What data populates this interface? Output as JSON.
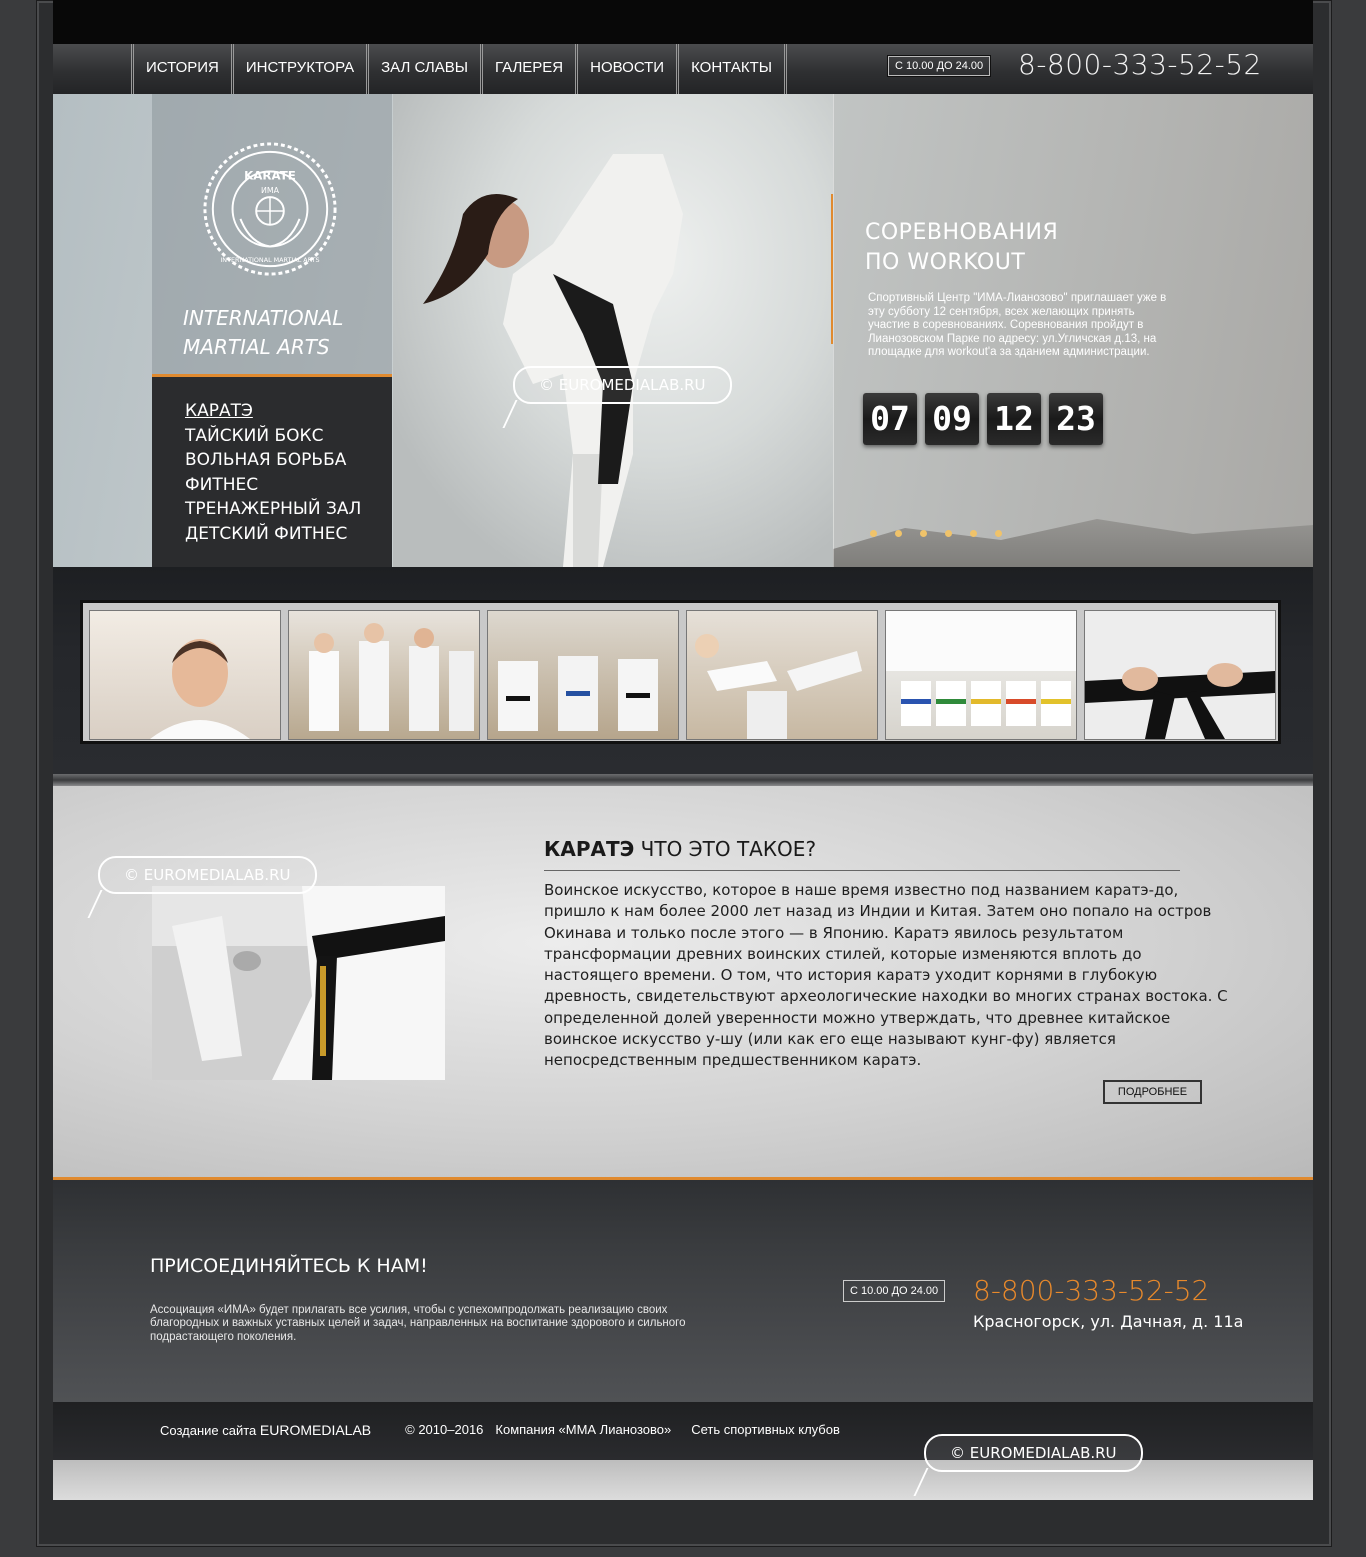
{
  "nav": {
    "items": [
      "ИСТОРИЯ",
      "ИНСТРУКТОРА",
      "ЗАЛ СЛАВЫ",
      "ГАЛЕРЕЯ",
      "НОВОСТИ",
      "КОНТАКТЫ"
    ],
    "hours": "С 10.00 ДО 24.00",
    "phone": "8-800-333-52-52"
  },
  "hero": {
    "emblem_text": [
      "KARATE",
      "ИМА",
      "INTERNATIONAL MARTIAL ARTS"
    ],
    "brand_line1": "INTERNATIONAL",
    "brand_line2": "MARTIAL ARTS",
    "menu": [
      "КАРАТЭ",
      "ТАЙСКИЙ БОКС",
      "ВОЛЬНАЯ БОРЬБА",
      "ФИТНЕС",
      "ТРЕНАЖЕРНЫЙ ЗАЛ",
      "ДЕТСКИЙ ФИТНЕС"
    ],
    "watermark": "© EUROMEDIALAB.RU",
    "event_title_line1": "СОРЕВНОВАНИЯ",
    "event_title_line2": "ПО WORKOUT",
    "event_text": "Спортивный Центр \"ИМА-Лианозово\" приглашает уже в эту субботу 12 сентября, всех желающих принять участие в соревнованиях. Соревнования пройдут в Лианозовском Парке по адресу: ул.Угличская д.13, на площадке для workout'а за зданием администрации.",
    "countdown": [
      "07",
      "09",
      "12",
      "23"
    ],
    "slides_count": 6
  },
  "gallery": {
    "thumbs": [
      "boy-portrait",
      "kids-training",
      "kids-class",
      "kids-kicking",
      "kids-sitting",
      "black-belt"
    ]
  },
  "about": {
    "watermark": "© EUROMEDIALAB.RU",
    "title_bold": "КАРАТЭ",
    "title_rest": " ЧТО ЭТО ТАКОЕ?",
    "text": "Воинское искусство, которое в наше время известно под названием каратэ-до, пришло к нам более 2000 лет назад из Индии и Китая. Затем оно попало на остров Окинава и только после этого — в Японию. Каратэ явилось результатом трансформации древних воинских стилей, которые изменяются вплоть до настоящего времени. О том, что история каратэ уходит корнями в глубокую древность, свидетельствуют археологические находки во многих странах востока. С определенной долей уверенности можно утверждать, что древнее китайское воинское искусство у-шу (или как его еще называют кунг-фу) является непосредственным предшественником каратэ.",
    "more_button": "ПОДРОБНЕЕ"
  },
  "join": {
    "title": "ПРИСОЕДИНЯЙТЕСЬ К НАМ!",
    "text": "Ассоциация «ИМА» будет прилагать все усилия, чтобы с успехомпродолжать реализацию своих благородных и важных уставных целей и задач, направленных на воспитание здорового и сильного подрастающего поколения.",
    "hours": "С 10.00 ДО 24.00",
    "phone": "8-800-333-52-52",
    "address": "Красногорск, ул. Дачная, д. 11а"
  },
  "footer": {
    "created_prefix": "Создание сайта ",
    "created_brand": "EUROMEDIALAB",
    "copyright": "© 2010–2016",
    "company": "Компания «ММА Лианозово»",
    "network": "Сеть спортивных клубов",
    "watermark": "© EUROMEDIALAB.RU"
  },
  "colors": {
    "accent": "#e08a2f",
    "dark": "#2b2c2e",
    "phone_orange": "#e8892b"
  }
}
